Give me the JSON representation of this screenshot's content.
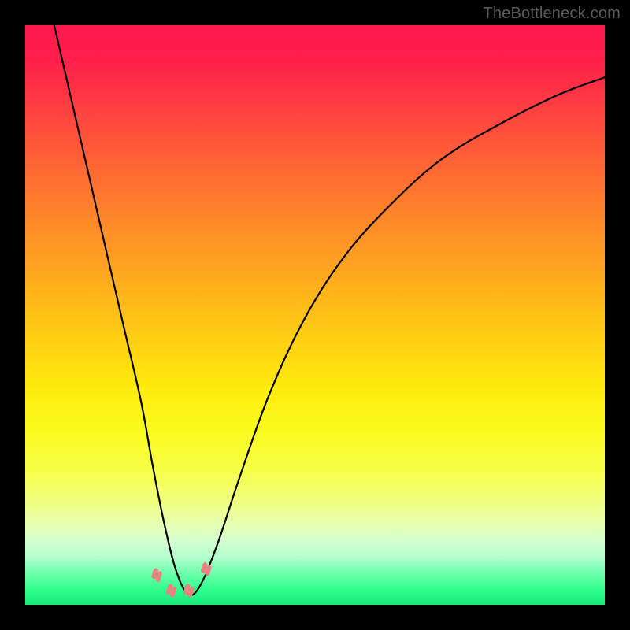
{
  "watermark": "TheBottleneck.com",
  "chart_data": {
    "type": "line",
    "title": "",
    "xlabel": "",
    "ylabel": "",
    "xlim": [
      0,
      100
    ],
    "ylim": [
      0,
      100
    ],
    "grid": false,
    "legend": false,
    "series": [
      {
        "name": "bottleneck-curve",
        "x": [
          5,
          8,
          11,
          14,
          17,
          20,
          22,
          24,
          26,
          28,
          30,
          33,
          37,
          42,
          48,
          55,
          63,
          72,
          82,
          92,
          100
        ],
        "y": [
          100,
          87,
          74,
          61,
          48,
          35,
          24,
          14,
          6,
          2,
          3,
          10,
          22,
          36,
          49,
          60,
          69,
          77,
          83,
          88,
          91
        ]
      }
    ],
    "markers": [
      {
        "name": "marker-left-pair",
        "x": 22.5,
        "y": 4.5,
        "color": "#e98383"
      },
      {
        "name": "marker-trough-a",
        "x": 25.0,
        "y": 1.8,
        "color": "#e98383"
      },
      {
        "name": "marker-trough-b",
        "x": 28.0,
        "y": 1.8,
        "color": "#e98383"
      },
      {
        "name": "marker-right-pair",
        "x": 31.0,
        "y": 5.5,
        "color": "#e98383"
      }
    ],
    "background_gradient": {
      "top": "#ff174e",
      "bottom": "#19e97c",
      "description": "vertical rainbow gradient red→orange→yellow→green"
    }
  }
}
